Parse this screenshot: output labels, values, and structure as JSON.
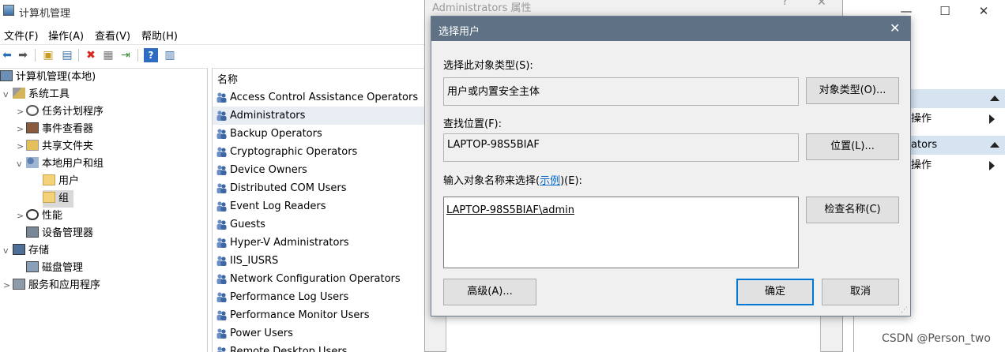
{
  "window": {
    "title": "计算机管理",
    "minimize": "—",
    "maximize": "☐",
    "close": "✕"
  },
  "menu": [
    "文件(F)",
    "操作(A)",
    "查看(V)",
    "帮助(H)"
  ],
  "toolbar": {
    "icons": [
      "back-arrow-icon",
      "forward-arrow-icon",
      "up-folder-icon",
      "show-hide-tree-icon",
      "delete-icon",
      "properties-icon",
      "export-icon",
      "help-icon",
      "view-icon"
    ],
    "colors": {
      "delete": "#d9261c",
      "help": "#2d6cc0"
    }
  },
  "tree": [
    {
      "label": "计算机管理(本地)",
      "twisty": "",
      "icon": "computer-icon"
    },
    {
      "label": "系统工具",
      "twisty": "v",
      "icon": "tools-icon"
    },
    {
      "label": "任务计划程序",
      "twisty": ">",
      "icon": "clock-icon"
    },
    {
      "label": "事件查看器",
      "twisty": ">",
      "icon": "event-viewer-icon"
    },
    {
      "label": "共享文件夹",
      "twisty": ">",
      "icon": "shared-folder-icon"
    },
    {
      "label": "本地用户和组",
      "twisty": "v",
      "icon": "users-icon"
    },
    {
      "label": "用户",
      "twisty": "",
      "icon": "folder-icon"
    },
    {
      "label": "组",
      "twisty": "",
      "icon": "folder-icon"
    },
    {
      "label": "性能",
      "twisty": ">",
      "icon": "performance-icon"
    },
    {
      "label": "设备管理器",
      "twisty": "",
      "icon": "device-manager-icon"
    },
    {
      "label": "存储",
      "twisty": "v",
      "icon": "storage-icon"
    },
    {
      "label": "磁盘管理",
      "twisty": "",
      "icon": "disk-icon"
    },
    {
      "label": "服务和应用程序",
      "twisty": ">",
      "icon": "services-icon"
    }
  ],
  "list": {
    "column_header": "名称",
    "groups": [
      "Access Control Assistance Operators",
      "Administrators",
      "Backup Operators",
      "Cryptographic Operators",
      "Device Owners",
      "Distributed COM Users",
      "Event Log Readers",
      "Guests",
      "Hyper-V Administrators",
      "IIS_IUSRS",
      "Network Configuration Operators",
      "Performance Log Users",
      "Performance Monitor Users",
      "Power Users",
      "Remote Desktop Users"
    ]
  },
  "actions": {
    "section2": "ators",
    "item": "操作"
  },
  "properties": {
    "title": "Administrators 属性",
    "help": "?",
    "close": "✕"
  },
  "dialog": {
    "title": "选择用户",
    "close": "✕",
    "object_type_label": "选择此对象类型(S):",
    "object_type_value": "用户或内置安全主体",
    "object_type_button": "对象类型(O)...",
    "location_label": "查找位置(F):",
    "location_value": "LAPTOP-98S5BIAF",
    "location_button": "位置(L)...",
    "enter_label_pre": "输入对象名称来选择(",
    "enter_label_link": "示例",
    "enter_label_post": ")(E):",
    "enter_value": "LAPTOP-98S5BIAF\\admin",
    "check_button": "检查名称(C)",
    "advanced_button": "高级(A)...",
    "ok_button": "确定",
    "cancel_button": "取消"
  },
  "watermark": "CSDN @Person_two"
}
